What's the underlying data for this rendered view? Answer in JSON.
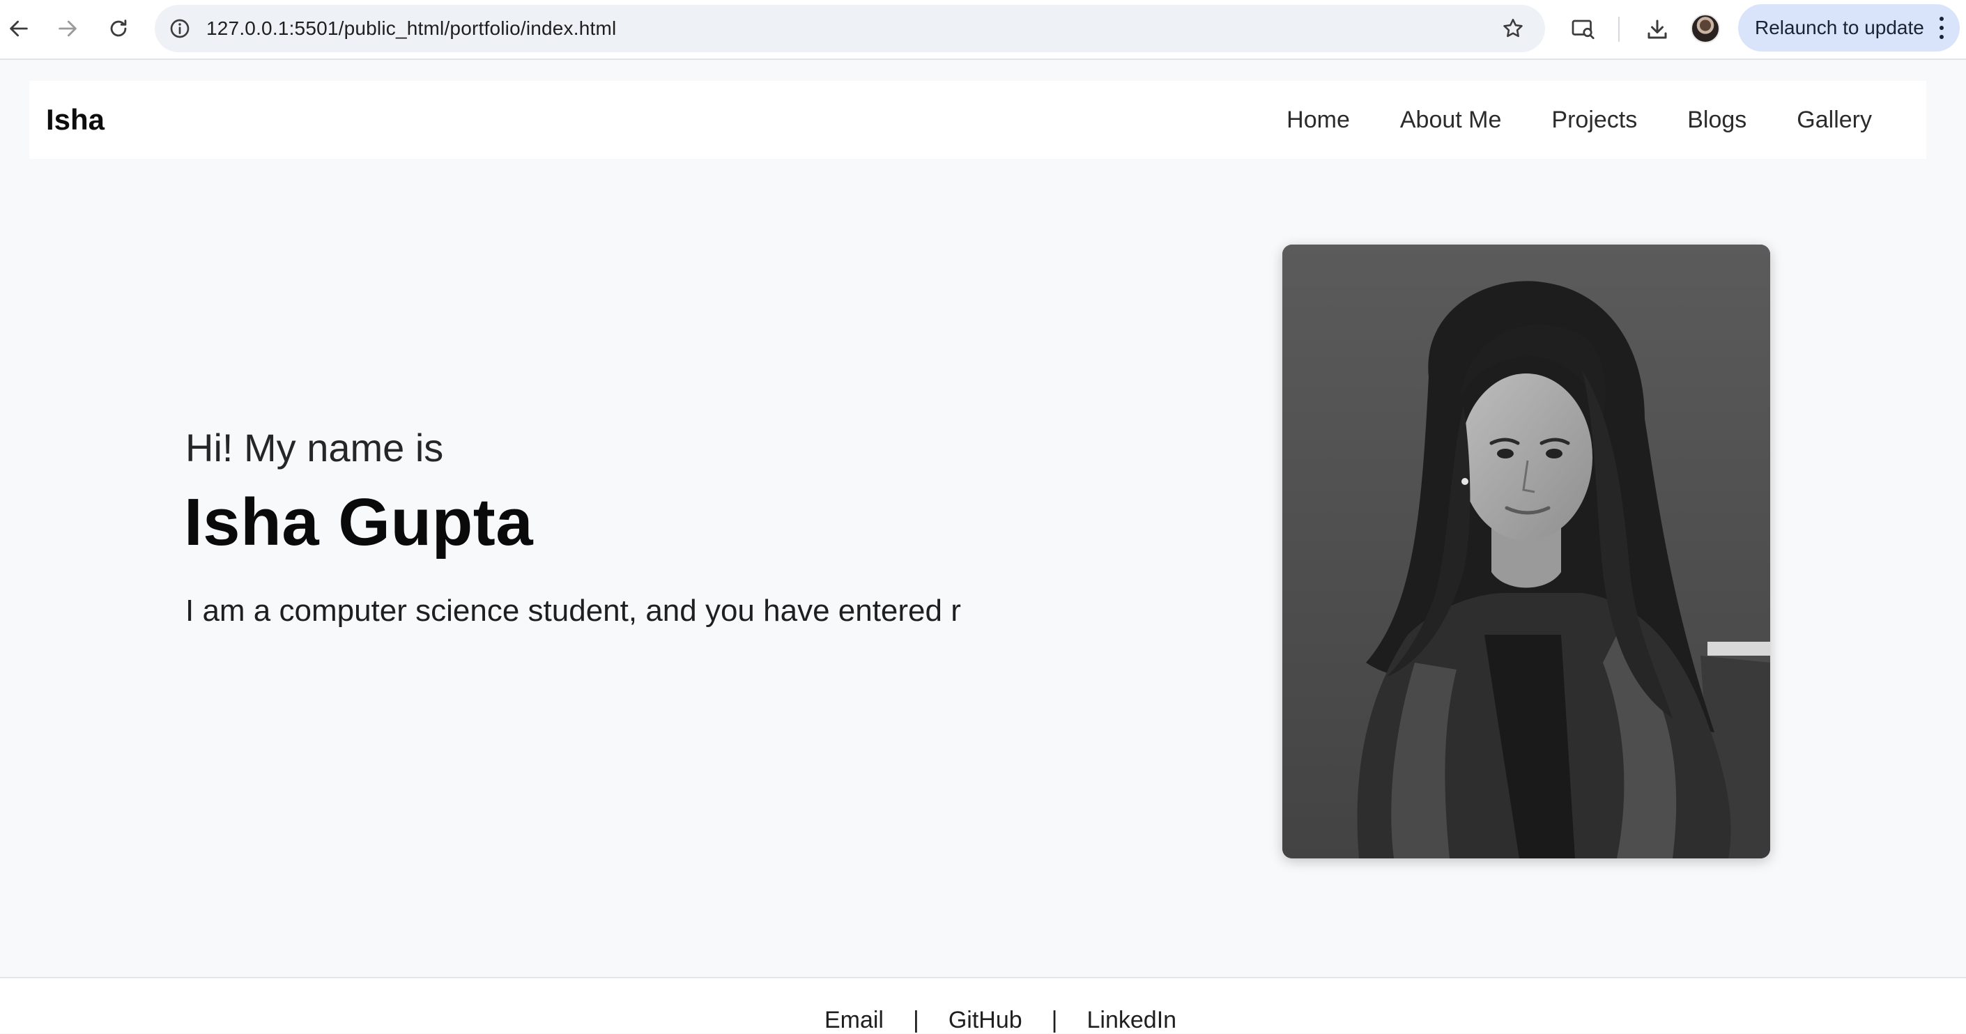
{
  "browser": {
    "url": "127.0.0.1:5501/public_html/portfolio/index.html",
    "relaunch_label": "Relaunch to update"
  },
  "header": {
    "brand": "Isha",
    "menu": [
      {
        "label": "Home"
      },
      {
        "label": "About Me"
      },
      {
        "label": "Projects"
      },
      {
        "label": "Blogs"
      },
      {
        "label": "Gallery"
      }
    ]
  },
  "hero": {
    "greeting": "Hi! My name is",
    "name": "Isha Gupta",
    "tagline": "I am a computer science student, and you have entered r"
  },
  "footer": {
    "links": [
      {
        "label": "Email"
      },
      {
        "label": "GitHub"
      },
      {
        "label": "LinkedIn"
      }
    ],
    "separator": "|"
  },
  "icons": {
    "back": "arrow-left-icon",
    "forward": "arrow-right-icon",
    "reload": "reload-icon",
    "site_info": "info-icon",
    "bookmark": "star-icon",
    "screen_search": "screen-search-icon",
    "download": "download-icon",
    "menu": "kebab-menu-icon"
  }
}
